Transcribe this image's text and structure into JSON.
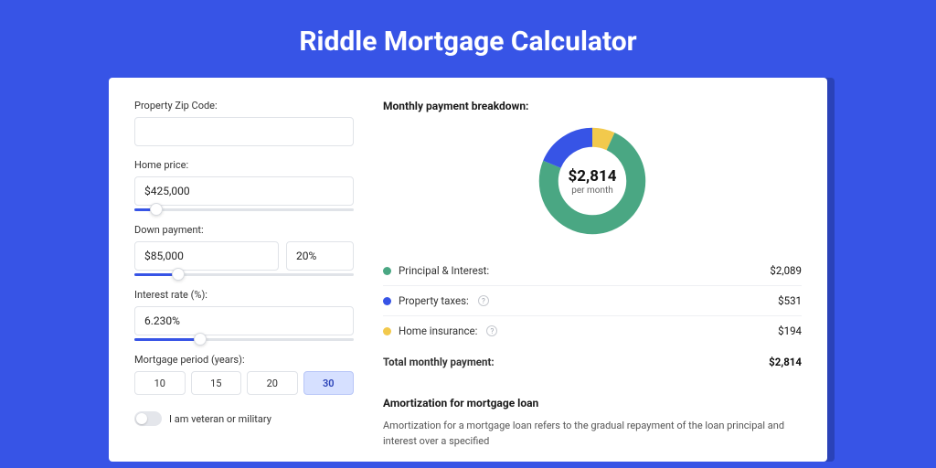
{
  "header": {
    "title": "Riddle Mortgage Calculator"
  },
  "colors": {
    "principal": "#4aa783",
    "taxes": "#3754e6",
    "insurance": "#f2c94c"
  },
  "form": {
    "zip": {
      "label": "Property Zip Code:",
      "value": ""
    },
    "home_price": {
      "label": "Home price:",
      "value": "$425,000",
      "slider_pct": 10
    },
    "down_payment": {
      "label": "Down payment:",
      "value": "$85,000",
      "pct_value": "20%",
      "slider_pct": 20
    },
    "interest": {
      "label": "Interest rate (%):",
      "value": "6.230%",
      "slider_pct": 30
    },
    "period": {
      "label": "Mortgage period (years):",
      "options": [
        "10",
        "15",
        "20",
        "30"
      ],
      "selected": "30"
    },
    "veteran": {
      "label": "I am veteran or military",
      "checked": false
    }
  },
  "breakdown": {
    "title": "Monthly payment breakdown:",
    "center_amount": "$2,814",
    "center_sub": "per month",
    "items": [
      {
        "label": "Principal & Interest:",
        "value": "$2,089",
        "num": 2089,
        "color": "#4aa783",
        "has_info": false
      },
      {
        "label": "Property taxes:",
        "value": "$531",
        "num": 531,
        "color": "#3754e6",
        "has_info": true
      },
      {
        "label": "Home insurance:",
        "value": "$194",
        "num": 194,
        "color": "#f2c94c",
        "has_info": true
      }
    ],
    "total_label": "Total monthly payment:",
    "total_value": "$2,814"
  },
  "amortization": {
    "title": "Amortization for mortgage loan",
    "text": "Amortization for a mortgage loan refers to the gradual repayment of the loan principal and interest over a specified"
  },
  "chart_data": {
    "type": "pie",
    "title": "Monthly payment breakdown",
    "series": [
      {
        "name": "Principal & Interest",
        "value": 2089
      },
      {
        "name": "Property taxes",
        "value": 531
      },
      {
        "name": "Home insurance",
        "value": 194
      }
    ],
    "total": 2814,
    "center_label": "$2,814 per month"
  }
}
